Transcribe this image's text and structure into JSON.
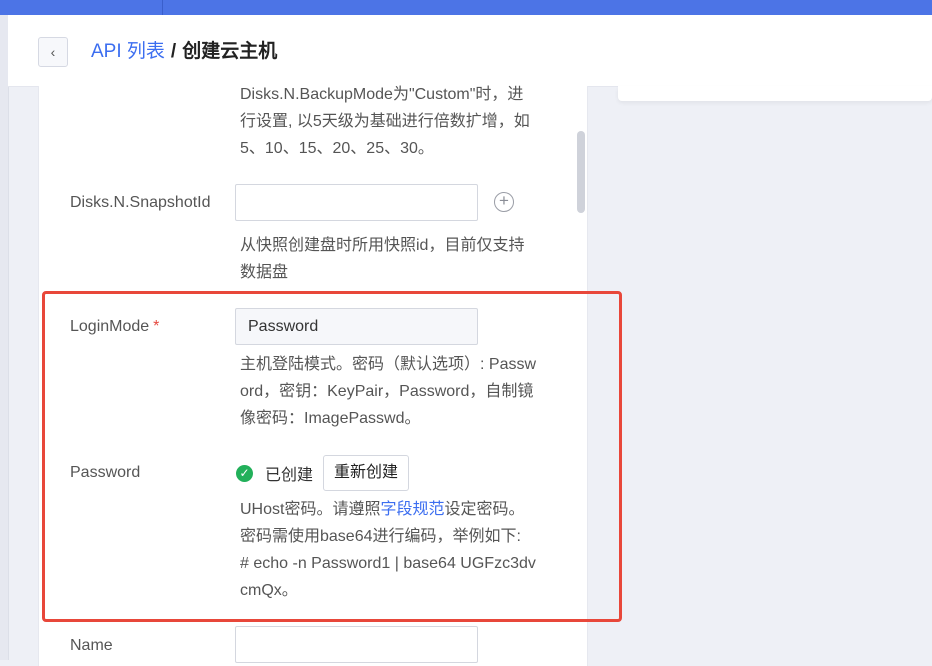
{
  "header": {
    "back_icon": "chevron-left-icon",
    "crumb_link": "API 列表",
    "crumb_sep": "/",
    "crumb_current": "创建云主机"
  },
  "backup": {
    "desc_lines": [
      "Disks.N.BackupMode为\"Custom\"时，进",
      "行设置, 以5天级为基础进行倍数扩增，如",
      "5、10、15、20、25、30。"
    ]
  },
  "snapshot": {
    "label": "Disks.N.SnapshotId",
    "value": "",
    "add_icon": "plus-circle-icon",
    "desc_lines": [
      "从快照创建盘时所用快照id，目前仅支持",
      "数据盘"
    ]
  },
  "login_mode": {
    "label": "LoginMode",
    "required_mark": "*",
    "value": "Password",
    "desc_lines": [
      "主机登陆模式。密码（默认选项）: Passw",
      "ord，密钥：KeyPair，Password，自制镜",
      "像密码：ImagePasswd。"
    ]
  },
  "password": {
    "label": "Password",
    "status_icon": "check-circle-icon",
    "status_text": "已创建",
    "recreate_label": "重新创建",
    "desc_before_link": "UHost密码。请遵照",
    "desc_link": "字段规范",
    "desc_after_link": "设定密码。",
    "desc_lines": [
      "密码需使用base64进行编码，举例如下:",
      "# echo -n Password1 | base64 UGFzc3dv",
      "cmQx。"
    ]
  },
  "name": {
    "label": "Name",
    "value": ""
  },
  "colors": {
    "topbar": "#4c74e6",
    "link": "#3c6ef0",
    "highlight": "#e8473a",
    "success": "#22b05a",
    "required": "#e5483f"
  }
}
